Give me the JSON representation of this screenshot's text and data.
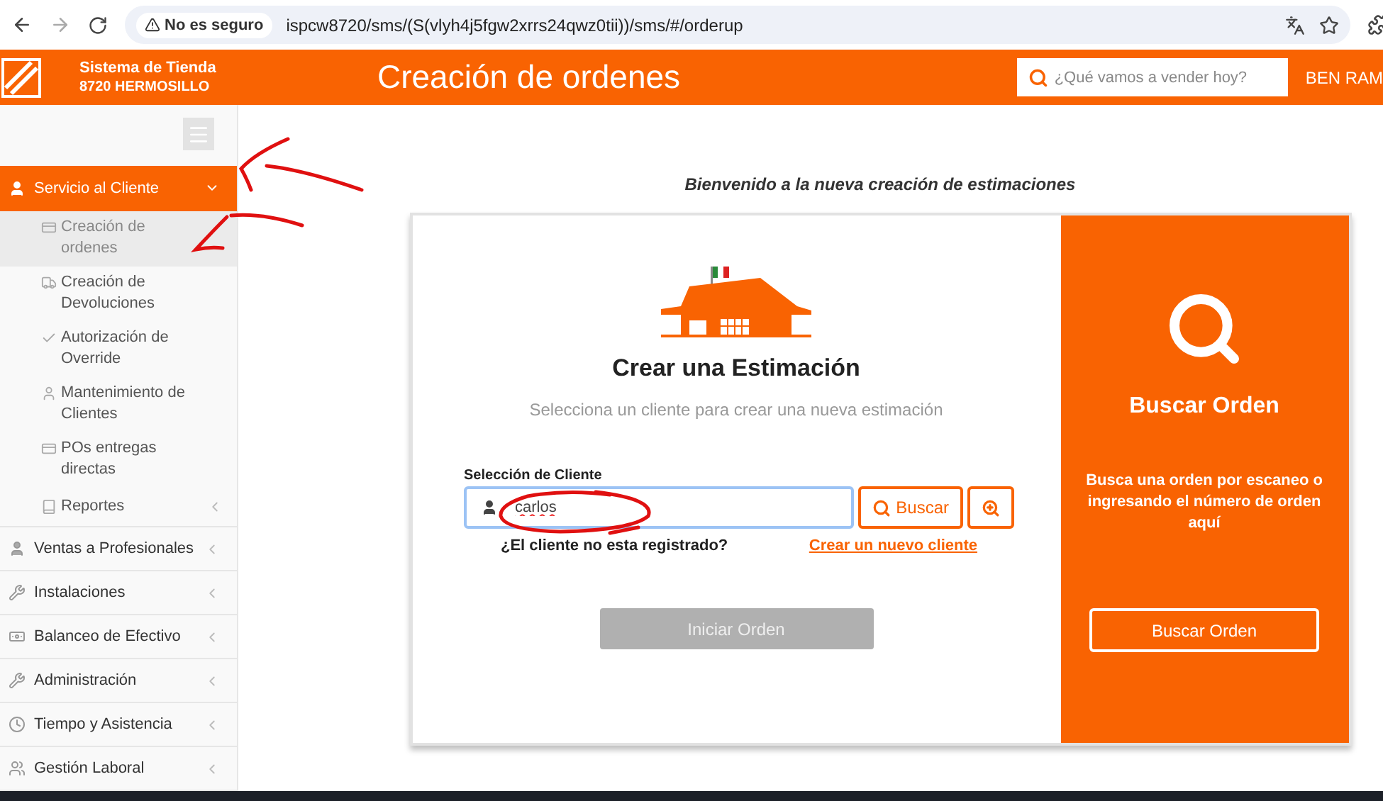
{
  "browser": {
    "security": "No es seguro",
    "url": "ispcw8720/sms/(S(vlyh4j5fgw2xrrs24qwz0tii))/sms/#/orderup"
  },
  "header": {
    "system": "Sistema de Tienda",
    "store": "8720 HERMOSILLO",
    "title": "Creación de ordenes",
    "search": {
      "placeholder": "¿Qué vamos a vender hoy?"
    },
    "user": "BEN RAM"
  },
  "sidebar": {
    "items": [
      {
        "label": "Servicio al Cliente",
        "expanded": true,
        "children": [
          {
            "label": "Creación de ordenes",
            "selected": true,
            "submenu": false
          },
          {
            "label": "Creación de Devoluciones",
            "selected": false,
            "submenu": false
          },
          {
            "label": "Autorización de Override",
            "selected": false,
            "submenu": false
          },
          {
            "label": "Mantenimiento de Clientes",
            "selected": false,
            "submenu": false
          },
          {
            "label": "POs entregas directas",
            "selected": false,
            "submenu": false
          },
          {
            "label": "Reportes",
            "selected": false,
            "submenu": true
          }
        ]
      },
      {
        "label": "Ventas a Profesionales",
        "expanded": false
      },
      {
        "label": "Instalaciones",
        "expanded": false
      },
      {
        "label": "Balanceo de Efectivo",
        "expanded": false
      },
      {
        "label": "Administración",
        "expanded": false
      },
      {
        "label": "Tiempo y Asistencia",
        "expanded": false
      },
      {
        "label": "Gestión Laboral",
        "expanded": false
      }
    ]
  },
  "main": {
    "welcome": "Bienvenido a la nueva creación de estimaciones",
    "estimate": {
      "title": "Crear una Estimación",
      "subtitle": "Selecciona un cliente para crear una nueva estimación",
      "field_label": "Selección de Cliente",
      "value": "carlos",
      "search_button": "Buscar",
      "question": "¿El cliente no esta registrado?",
      "link": "Crear un nuevo cliente",
      "start_button": {
        "label": "Iniciar Orden",
        "disabled": true
      }
    },
    "find": {
      "title": "Buscar Orden",
      "text": "Busca una orden por escaneo o ingresando el número de orden aquí",
      "button": "Buscar Orden"
    }
  }
}
